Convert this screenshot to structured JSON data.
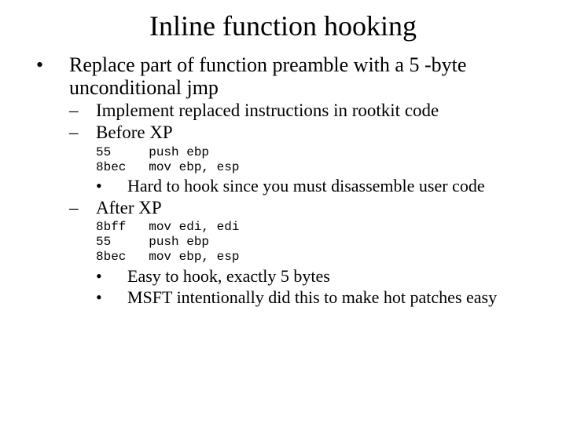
{
  "title": "Inline function hooking",
  "lvl1_text": "Replace part of function preamble with a 5 -byte unconditional jmp",
  "sub1": "Implement replaced instructions in rootkit code",
  "sub2": "Before XP",
  "code_before": "55     push ebp\n8bec   mov ebp, esp",
  "before_note": "Hard to hook since you must disassemble user code",
  "sub3": "After XP",
  "code_after": "8bff   mov edi, edi\n55     push ebp\n8bec   mov ebp, esp",
  "after_note1": "Easy to hook, exactly 5 bytes",
  "after_note2": "MSFT intentionally did this to make hot patches easy"
}
